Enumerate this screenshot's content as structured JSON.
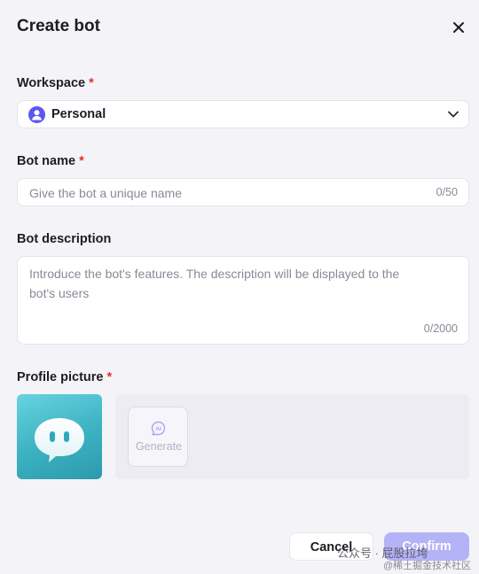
{
  "dialog": {
    "title": "Create bot"
  },
  "workspace": {
    "label": "Workspace",
    "required_mark": "*",
    "selected": "Personal"
  },
  "bot_name": {
    "label": "Bot name",
    "required_mark": "*",
    "placeholder": "Give the bot a unique name",
    "counter": "0/50"
  },
  "bot_description": {
    "label": "Bot description",
    "placeholder": "Introduce the bot's features. The description will be displayed to the bot's users",
    "counter": "0/2000"
  },
  "profile_picture": {
    "label": "Profile picture",
    "required_mark": "*",
    "generate_label": "Generate"
  },
  "footer": {
    "cancel_label": "Cancel",
    "confirm_label": "Confirm"
  },
  "watermark": {
    "line1": "公众号 · 屁股拉垮",
    "line2": "@稀土掘金技术社区"
  },
  "colors": {
    "accent": "#5b57f0",
    "confirm_disabled": "#b4b3f7",
    "required": "#e5302f",
    "avatar_bg": "#3bb1c2"
  },
  "icons": {
    "close": "close-icon",
    "workspace_avatar": "user-avatar-icon",
    "dropdown": "chevron-down-icon",
    "generate": "ai-sparkle-icon",
    "bot_face": "chat-bubble-bot-icon"
  }
}
